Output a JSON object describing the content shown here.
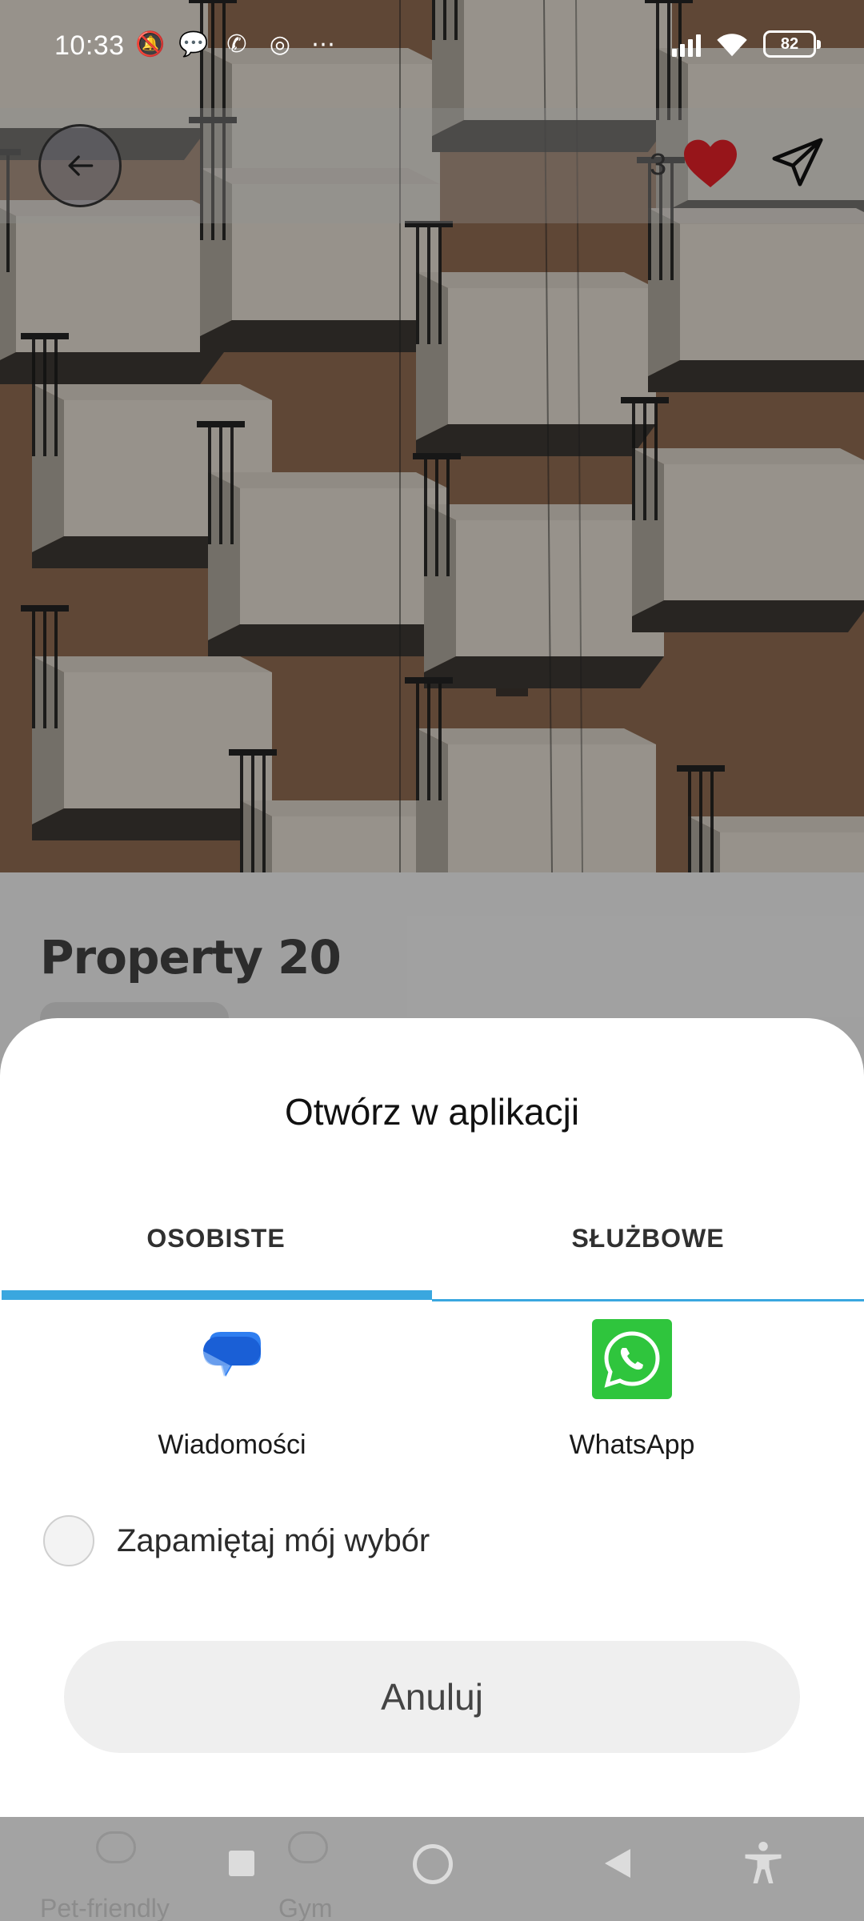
{
  "status_bar": {
    "time": "10:33",
    "left_icons": [
      "mute-vibrate-icon",
      "chat-bubble-icon",
      "missed-call-icon",
      "whatsapp-icon",
      "more-dots-icon"
    ],
    "right_icons": [
      "signal-icon",
      "wifi-icon",
      "battery-icon"
    ],
    "battery_level": "82"
  },
  "top_bar": {
    "back_icon": "arrow-left-icon",
    "like_count": "3",
    "like_icon": "heart-icon",
    "share_icon": "send-icon"
  },
  "property": {
    "title": "Property 20"
  },
  "sheet": {
    "title": "Otwórz w aplikacji",
    "tabs": [
      {
        "label": "OSOBISTE",
        "selected": true
      },
      {
        "label": "SŁUŻBOWE",
        "selected": false
      }
    ],
    "apps": [
      {
        "label": "Wiadomości",
        "icon": "messages-icon"
      },
      {
        "label": "WhatsApp",
        "icon": "whatsapp-icon"
      }
    ],
    "remember_label": "Zapamiętaj mój wybór",
    "remember_checked": false,
    "cancel_label": "Anuluj"
  },
  "bottom_nav": {
    "items": [
      {
        "label": "Pet-friendly",
        "icon": "info-icon"
      },
      {
        "label": "Gym",
        "icon": "dumbbell-icon"
      }
    ]
  },
  "colors": {
    "tab_indicator": "#3aa7df",
    "whatsapp_green": "#2fc53d",
    "messages_blue": "#1a5fd6",
    "heart_red": "#d81f26"
  }
}
